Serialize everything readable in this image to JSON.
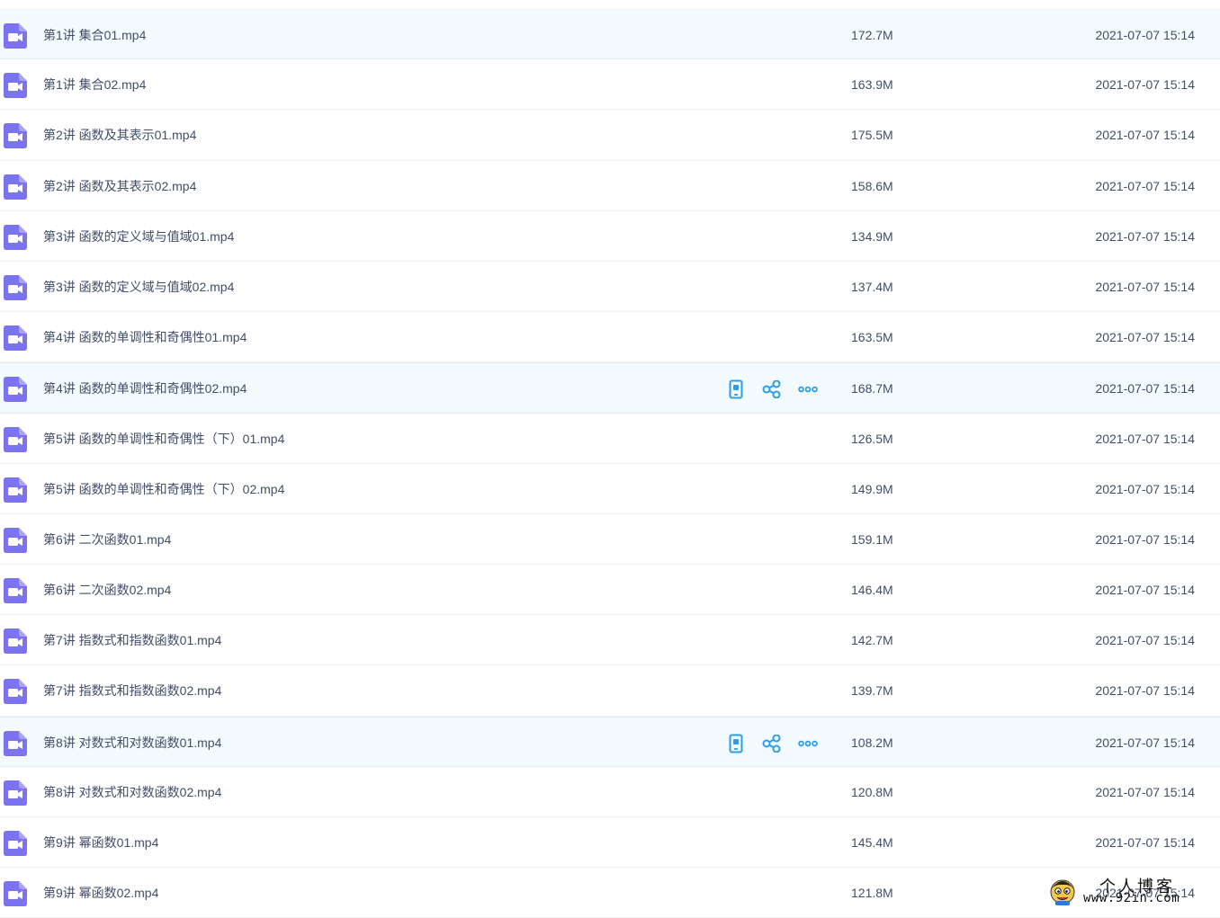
{
  "colors": {
    "icon_purple": "#7b73f0",
    "action_blue": "#2a9ee8",
    "text": "#424e67",
    "row_highlight": "#f4fbff"
  },
  "row_icon": "video-file-icon",
  "action_icons": [
    "phone-icon",
    "share-icon",
    "more-icon"
  ],
  "files": [
    {
      "name": "第1讲 集合01.mp4",
      "size": "172.7M",
      "date": "2021-07-07 15:14"
    },
    {
      "name": "第1讲 集合02.mp4",
      "size": "163.9M",
      "date": "2021-07-07 15:14"
    },
    {
      "name": "第2讲 函数及其表示01.mp4",
      "size": "175.5M",
      "date": "2021-07-07 15:14"
    },
    {
      "name": "第2讲 函数及其表示02.mp4",
      "size": "158.6M",
      "date": "2021-07-07 15:14"
    },
    {
      "name": "第3讲 函数的定义域与值域01.mp4",
      "size": "134.9M",
      "date": "2021-07-07 15:14"
    },
    {
      "name": "第3讲 函数的定义域与值域02.mp4",
      "size": "137.4M",
      "date": "2021-07-07 15:14"
    },
    {
      "name": "第4讲 函数的单调性和奇偶性01.mp4",
      "size": "163.5M",
      "date": "2021-07-07 15:14"
    },
    {
      "name": "第4讲 函数的单调性和奇偶性02.mp4",
      "size": "168.7M",
      "date": "2021-07-07 15:14"
    },
    {
      "name": "第5讲 函数的单调性和奇偶性（下）01.mp4",
      "size": "126.5M",
      "date": "2021-07-07 15:14"
    },
    {
      "name": "第5讲 函数的单调性和奇偶性（下）02.mp4",
      "size": "149.9M",
      "date": "2021-07-07 15:14"
    },
    {
      "name": "第6讲 二次函数01.mp4",
      "size": "159.1M",
      "date": "2021-07-07 15:14"
    },
    {
      "name": "第6讲 二次函数02.mp4",
      "size": "146.4M",
      "date": "2021-07-07 15:14"
    },
    {
      "name": "第7讲 指数式和指数函数01.mp4",
      "size": "142.7M",
      "date": "2021-07-07 15:14"
    },
    {
      "name": "第7讲 指数式和指数函数02.mp4",
      "size": "139.7M",
      "date": "2021-07-07 15:14"
    },
    {
      "name": "第8讲 对数式和对数函数01.mp4",
      "size": "108.2M",
      "date": "2021-07-07 15:14"
    },
    {
      "name": "第8讲 对数式和对数函数02.mp4",
      "size": "120.8M",
      "date": "2021-07-07 15:14"
    },
    {
      "name": "第9讲 幂函数01.mp4",
      "size": "145.4M",
      "date": "2021-07-07 15:14"
    },
    {
      "name": "第9讲 幂函数02.mp4",
      "size": "121.8M",
      "date": "2021-07-07 15:14"
    }
  ],
  "hovered_rows": [
    0,
    7,
    14
  ],
  "rows_with_actions": [
    7,
    14
  ],
  "watermark": {
    "title": "个人博客",
    "url": "www.92in.com"
  }
}
